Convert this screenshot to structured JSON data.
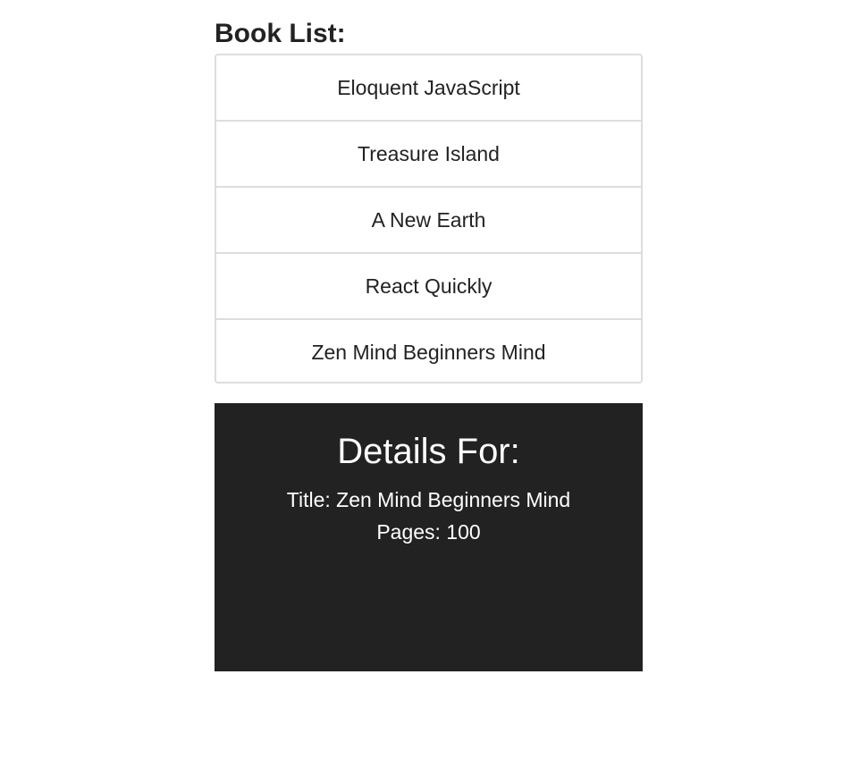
{
  "book_list": {
    "heading": "Book List:",
    "items": [
      {
        "title": "Eloquent JavaScript"
      },
      {
        "title": "Treasure Island"
      },
      {
        "title": "A New Earth"
      },
      {
        "title": "React Quickly"
      },
      {
        "title": "Zen Mind Beginners Mind"
      }
    ]
  },
  "details": {
    "heading": "Details For:",
    "title_line": "Title: Zen Mind Beginners Mind",
    "pages_line": "Pages: 100"
  },
  "colors": {
    "details_background": "#222222",
    "list_border": "#dddddd",
    "text": "#222222"
  }
}
